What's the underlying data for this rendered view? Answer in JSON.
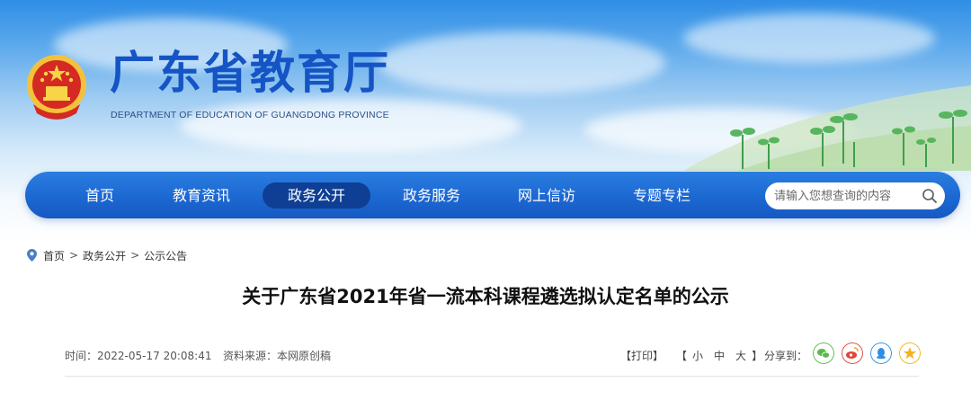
{
  "header": {
    "title": "广东省教育厅",
    "subtitle": "DEPARTMENT OF EDUCATION OF GUANGDONG PROVINCE",
    "emblem_icon": "national-emblem-icon"
  },
  "nav": {
    "items": [
      {
        "label": "首页"
      },
      {
        "label": "教育资讯"
      },
      {
        "label": "政务公开",
        "active": true
      },
      {
        "label": "政务服务"
      },
      {
        "label": "网上信访"
      },
      {
        "label": "专题专栏"
      }
    ],
    "search": {
      "placeholder": "请输入您想查询的内容",
      "icon": "search-icon"
    }
  },
  "breadcrumb": {
    "icon": "location-pin-icon",
    "items": [
      "首页",
      "政务公开",
      "公示公告"
    ],
    "separator": ">"
  },
  "article": {
    "title": "关于广东省2021年省一流本科课程遴选拟认定名单的公示",
    "time_label": "时间：",
    "time_value": "2022-05-17 20:08:41",
    "source_label": "资料来源：",
    "source_value": "本网原创稿",
    "print_label": "【打印】",
    "size_open": "【",
    "size_small": "小",
    "size_medium": "中",
    "size_large": "大",
    "size_close": "】",
    "share_label": "分享到："
  },
  "share": [
    {
      "name": "wechat",
      "icon": "wechat-icon",
      "color": "#5bb84a"
    },
    {
      "name": "weibo",
      "icon": "weibo-icon",
      "color": "#e1443a"
    },
    {
      "name": "qq",
      "icon": "qq-icon",
      "color": "#2f8fe4"
    },
    {
      "name": "qzone",
      "icon": "qzone-star-icon",
      "color": "#f2b31c"
    }
  ],
  "colors": {
    "nav_bg": "#1c68d2",
    "nav_active": "#0e3f94",
    "title_blue": "#1554c4"
  }
}
